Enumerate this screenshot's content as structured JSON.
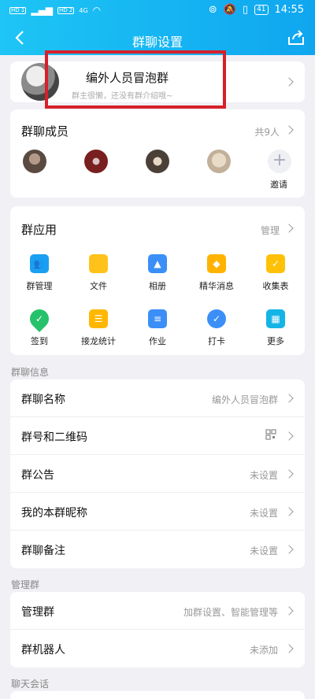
{
  "status_bar": {
    "sim1": "HD 1",
    "sim2": "HD 2",
    "network": "4G",
    "battery": "41",
    "time": "14:55"
  },
  "nav": {
    "title": "群聊设置"
  },
  "group": {
    "name": "编外人员冒泡群",
    "intro": "群主很懒，还没有群介绍哦~"
  },
  "members": {
    "title": "群聊成员",
    "count": "共9人",
    "invite": "邀请"
  },
  "apps": {
    "title": "群应用",
    "manage": "管理",
    "items": [
      {
        "label": "群管理",
        "icon": "group-manage-icon",
        "color": "#1aa0f0"
      },
      {
        "label": "文件",
        "icon": "folder-icon",
        "color": "#ffc21a"
      },
      {
        "label": "相册",
        "icon": "photo-icon",
        "color": "#3b8ff7"
      },
      {
        "label": "精华消息",
        "icon": "essence-icon",
        "color": "#ffb300"
      },
      {
        "label": "收集表",
        "icon": "form-icon",
        "color": "#ffc107"
      },
      {
        "label": "签到",
        "icon": "checkin-icon",
        "color": "#26c26b"
      },
      {
        "label": "接龙统计",
        "icon": "list-icon",
        "color": "#ffb700"
      },
      {
        "label": "作业",
        "icon": "homework-icon",
        "color": "#3b8ff7"
      },
      {
        "label": "打卡",
        "icon": "clock-in-icon",
        "color": "#3b8ff7"
      },
      {
        "label": "更多",
        "icon": "more-icon",
        "color": "#14b4e6"
      }
    ]
  },
  "info": {
    "section": "群聊信息",
    "rows": [
      {
        "title": "群聊名称",
        "value": "编外人员冒泡群"
      },
      {
        "title": "群号和二维码",
        "value": ""
      },
      {
        "title": "群公告",
        "value": "未设置"
      },
      {
        "title": "我的本群昵称",
        "value": "未设置"
      },
      {
        "title": "群聊备注",
        "value": "未设置"
      }
    ]
  },
  "manage": {
    "section": "管理群",
    "rows": [
      {
        "title": "管理群",
        "value": "加群设置、智能管理等"
      },
      {
        "title": "群机器人",
        "value": "未添加"
      }
    ]
  },
  "chat": {
    "section": "聊天会话"
  }
}
